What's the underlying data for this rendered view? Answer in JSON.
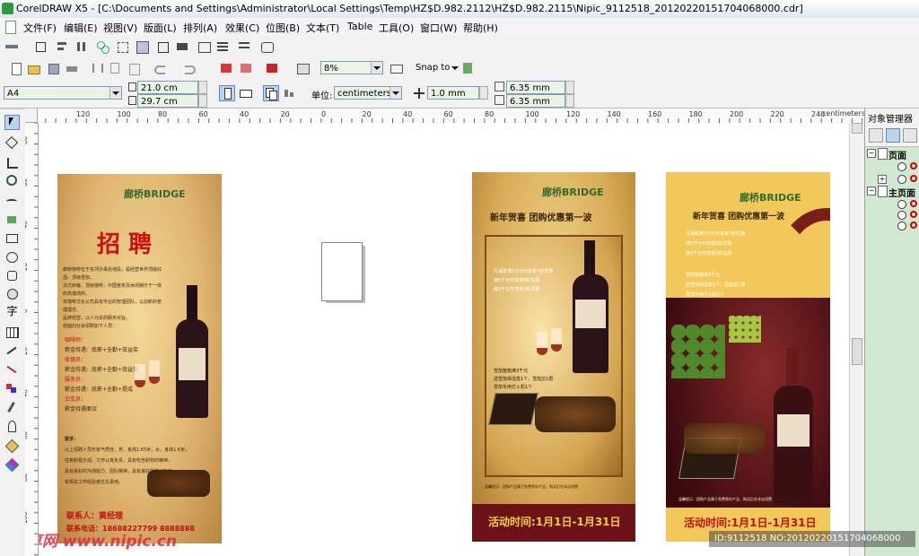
{
  "window": {
    "title": "CorelDRAW X5 - [C:\\Documents and Settings\\Administrator\\Local Settings\\Temp\\HZ$D.982.2112\\HZ$D.982.2115\\Nipic_9112518_20120220151704068000.cdr]"
  },
  "menu": [
    "文件(F)",
    "编辑(E)",
    "视图(V)",
    "版面(L)",
    "排列(A)",
    "效果(C)",
    "位图(B)",
    "文本(T)",
    "Table",
    "工具(O)",
    "窗口(W)",
    "帮助(H)"
  ],
  "standard_toolbar": {
    "zoom_value": "8%",
    "snap_label": "Snap to"
  },
  "property_bar": {
    "paper_size": "A4",
    "width": "21.0 cm",
    "height": "29.7 cm",
    "units_label": "单位:",
    "units_value": "centimeters",
    "nudge": "1.0 mm",
    "dup_x": "6.35 mm",
    "dup_y": "6.35 mm"
  },
  "ruler": {
    "unit": "centimeters",
    "h_labels": [
      "120",
      "100",
      "80",
      "60",
      "40",
      "20",
      "0",
      "20",
      "40",
      "60",
      "80",
      "100",
      "120",
      "140",
      "160",
      "180",
      "200",
      "220",
      "240"
    ],
    "v_labels": [
      "80",
      "60",
      "40",
      "20",
      "0",
      "20",
      "40",
      "60",
      "80",
      "100"
    ]
  },
  "docker": {
    "title": "对象管理器",
    "page_label": "页面",
    "master_label": "主页面"
  },
  "posters": {
    "recruit": {
      "brand": "廊桥BRIDGE",
      "title": "招 聘",
      "body": [
        "廊桥咖啡位于东坪办事处地段，是经营世界顶级红酒、顶级雪茄、",
        "法式西餐、顶级咖啡，中国茗茶及休闲娱乐于一体的高端场所。",
        "本咖啡文化公司具有专业的管理团队，以创新的管理理念、",
        "品牌经营，以人为本的服务宗旨，",
        "现面向社会招聘如下人员："
      ],
      "roles": [
        {
          "role": "咖啡师：",
          "desc": "薪金待遇：底薪+全勤+效益奖"
        },
        {
          "role": "收银员：",
          "desc": "薪金待遇：底薪+全勤+效益奖"
        },
        {
          "role": "服务员：",
          "desc": "薪金待遇：底薪+全勤+提成"
        },
        {
          "role": "泊车员：",
          "desc": "薪金待遇面议"
        }
      ],
      "req_title": "要求：",
      "req": [
        "以上招聘人员形象气质佳，男，身高1.65米，女，身高1.6米，",
        "性格积极乐观，工作认真负责，具有吃苦耐劳的精神，",
        "具有良好的沟通能力、团队精神，具有良好的学习能力、",
        "有相关工作经验者优先录用。"
      ],
      "contact": "联系人：黄经理",
      "phone": "联系电话：18688227799  8888888"
    },
    "wine1": {
      "brand": "廊桥BRIDGE",
      "headline": "新年贺喜  团购优惠第一波",
      "offers": [
        "凡消费满1万元可享受7折优惠",
        "满5千元可享受8折优惠",
        "满3千元可享受9折优惠"
      ],
      "gifts": [
        "雪茄整箱满3千元",
        "送雪茄保湿盒1个，雪茄剪1把",
        "雪茄专用打火机1个"
      ],
      "note": "温馨提示：团购产品属于免费寄存产品，购买后在本店消费",
      "footer": "活动时间:1月1日-1月31日"
    },
    "wine2": {
      "brand": "廊桥BRIDGE",
      "headline": "新年贺喜  团购优惠第一波",
      "offers": [
        "凡消费满1万元可享受7折优惠",
        "满5千元可享受8折优惠",
        "满3千元可享受9折优惠"
      ],
      "gifts": [
        "雪茄整箱满3千元",
        "送雪茄保湿盒1个，雪茄剪1把",
        "雪茄专用打火机1个"
      ],
      "note": "温馨提示：团购产品属于免费寄存产品，购买后在本店消费",
      "footer": "活动时间:1月1日-1月31日"
    }
  },
  "watermark": {
    "left": "昵享网 www.nipic.cn",
    "right": "ID:9112518 NO:20120220151704068000"
  }
}
